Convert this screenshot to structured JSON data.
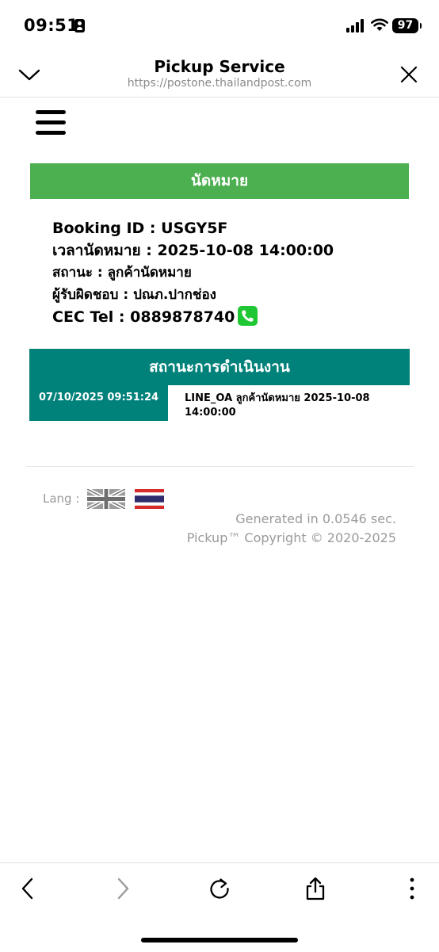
{
  "status_bar": {
    "time": "09:51",
    "battery": "97"
  },
  "browser": {
    "title": "Pickup Service",
    "url": "https://postone.thailandpost.com"
  },
  "appointment": {
    "header": "นัดหมาย",
    "booking_id_label": "Booking ID : ",
    "booking_id": "USGY5F",
    "time_label": "เวลานัดหมาย : ",
    "time_value": "2025-10-08 14:00:00",
    "status_label": "สถานะ : ",
    "status_value": "ลูกค้านัดหมาย",
    "responsible_label": "ผู้รับผิดชอบ : ",
    "responsible_value": "ปณภ.ปากช่อง",
    "cec_label": "CEC Tel : ",
    "cec_value": "0889878740"
  },
  "progress": {
    "header": "สถานะการดำเนินงาน",
    "entries": [
      {
        "datetime": "07/10/2025 09:51:24",
        "description_line1": "LINE_OA ลูกค้านัดหมาย 2025-10-08",
        "description_line2": "14:00:00"
      }
    ]
  },
  "footer": {
    "lang_label": "Lang :",
    "generated": "Generated in 0.0546 sec.",
    "copyright": "Pickup™ Copyright © 2020-2025"
  },
  "icons": {
    "phone": "phone-icon",
    "flag_en": "uk-flag-icon",
    "flag_th": "thai-flag-icon"
  },
  "colors": {
    "appointment_green": "#4caf50",
    "progress_teal": "#00827a",
    "phone_green": "#1fc734"
  }
}
